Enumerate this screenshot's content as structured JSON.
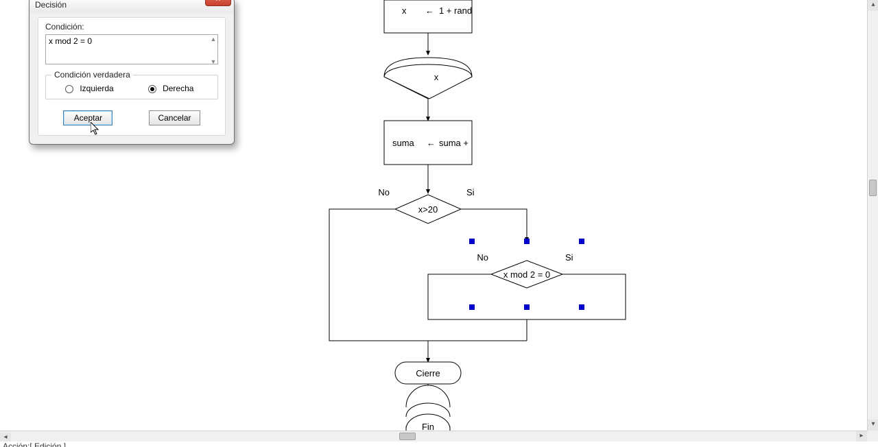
{
  "dialog": {
    "title": "Decisión",
    "close_glyph": "×",
    "condition_label": "Condición:",
    "condition_value": "x mod 2 = 0",
    "fieldset_legend": "Condición verdadera",
    "radio_left_label": "Izquierda",
    "radio_right_label": "Derecha",
    "radio_selected": "Derecha",
    "accept_label": "Aceptar",
    "cancel_label": "Cancelar"
  },
  "flowchart": {
    "nodes": {
      "assign_x": {
        "line1_left": "x",
        "line1_arrow": "←",
        "line1_right": "1 + rand"
      },
      "output_x": "x",
      "assign_suma": {
        "left": "suma",
        "arrow": "←",
        "right": "suma +"
      },
      "decision1": {
        "condition": "x>20",
        "no": "No",
        "si": "Si"
      },
      "decision2": {
        "condition": "x mod 2 = 0",
        "no": "No",
        "si": "Si"
      },
      "cierre": "Cierre",
      "fin": "Fin"
    }
  },
  "statusbar": {
    "text": "Acción:[ Edición ]"
  }
}
